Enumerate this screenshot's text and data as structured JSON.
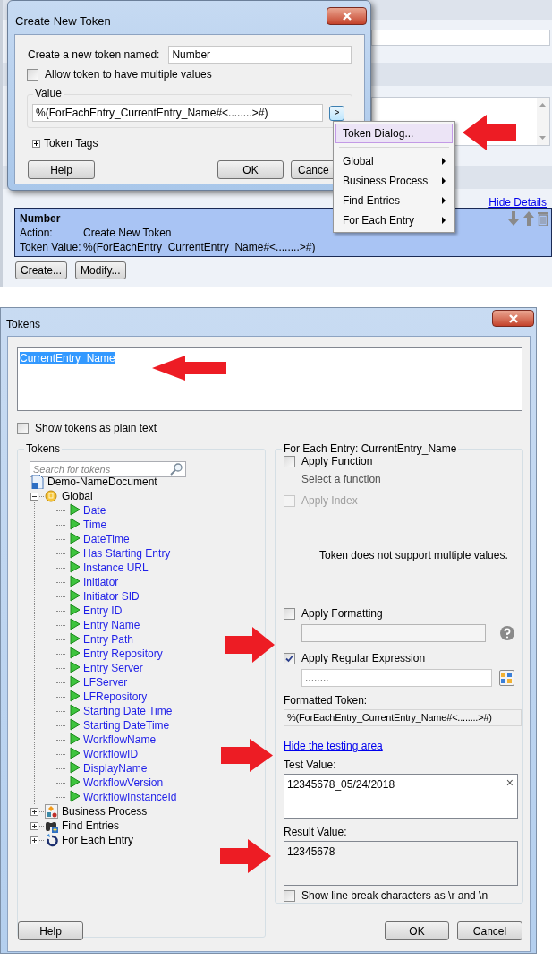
{
  "background_app": {
    "hide_details_link": "Hide Details",
    "selected_token": {
      "name": "Number",
      "rows": [
        {
          "label": "Action:",
          "value": "Create New Token"
        },
        {
          "label": "Token Value:",
          "value": "%(ForEachEntry_CurrentEntry_Name#<........>#)"
        }
      ]
    },
    "buttons": [
      "Create...",
      "Modify..."
    ]
  },
  "create_token_dialog": {
    "title": "Create New Token",
    "name_label": "Create a new token named:",
    "name_value": "Number",
    "multiple_values": {
      "label": "Allow token to have multiple values",
      "checked": false
    },
    "value_group": {
      "label": "Value",
      "value": "%(ForEachEntry_CurrentEntry_Name#<........>#)",
      "picker_button": ">"
    },
    "token_tags": {
      "label": "Token Tags",
      "expanded": false
    },
    "buttons": [
      "Help",
      "OK",
      "Cance"
    ]
  },
  "context_menu": {
    "sections": [
      [
        {
          "label": "Token Dialog...",
          "selected": true,
          "has_submenu": false
        }
      ],
      [
        {
          "label": "Global",
          "selected": false,
          "has_submenu": true
        },
        {
          "label": "Business Process",
          "selected": false,
          "has_submenu": true
        },
        {
          "label": "Find Entries",
          "selected": false,
          "has_submenu": true
        },
        {
          "label": "For Each Entry",
          "selected": false,
          "has_submenu": true
        }
      ]
    ]
  },
  "tokens_dialog": {
    "title": "Tokens",
    "expression": {
      "text": "CurrentEntry_Name",
      "selected": true
    },
    "plain_text": {
      "label": "Show tokens as plain text",
      "checked": false
    },
    "tokens_group": {
      "label": "Tokens",
      "search_placeholder": "Search for tokens",
      "tree": [
        {
          "label": "Demo-NameDocument",
          "kind": "document",
          "children": [
            {
              "label": "Global",
              "kind": "global",
              "expanded": true,
              "children": [
                {
                  "label": "Date",
                  "kind": "token"
                },
                {
                  "label": "Time",
                  "kind": "token"
                },
                {
                  "label": "DateTime",
                  "kind": "token"
                },
                {
                  "label": "Has Starting Entry",
                  "kind": "token"
                },
                {
                  "label": "Instance URL",
                  "kind": "token"
                },
                {
                  "label": "Initiator",
                  "kind": "token"
                },
                {
                  "label": "Initiator SID",
                  "kind": "token"
                },
                {
                  "label": "Entry ID",
                  "kind": "token"
                },
                {
                  "label": "Entry Name",
                  "kind": "token"
                },
                {
                  "label": "Entry Path",
                  "kind": "token"
                },
                {
                  "label": "Entry Repository",
                  "kind": "token"
                },
                {
                  "label": "Entry Server",
                  "kind": "token"
                },
                {
                  "label": "LFServer",
                  "kind": "token"
                },
                {
                  "label": "LFRepository",
                  "kind": "token"
                },
                {
                  "label": "Starting Date Time",
                  "kind": "token"
                },
                {
                  "label": "Starting DateTime",
                  "kind": "token"
                },
                {
                  "label": "WorkflowName",
                  "kind": "token"
                },
                {
                  "label": "WorkflowID",
                  "kind": "token"
                },
                {
                  "label": "DisplayName",
                  "kind": "token"
                },
                {
                  "label": "WorkflowVersion",
                  "kind": "token"
                },
                {
                  "label": "WorkflowInstanceId",
                  "kind": "token"
                }
              ]
            },
            {
              "label": "Business Process",
              "kind": "business",
              "expanded": false
            },
            {
              "label": "Find Entries",
              "kind": "find",
              "expanded": false
            },
            {
              "label": "For Each Entry",
              "kind": "foreach",
              "expanded": false
            }
          ]
        }
      ]
    },
    "options_group": {
      "label": "For Each Entry: CurrentEntry_Name",
      "apply_function": {
        "label": "Apply Function",
        "checked": false,
        "disabled": false,
        "hint": "Select a function"
      },
      "apply_index": {
        "label": "Apply Index",
        "checked": false,
        "disabled": true
      },
      "message": "Token does not support multiple values.",
      "apply_formatting": {
        "label": "Apply Formatting",
        "checked": false,
        "disabled": false
      },
      "apply_regex": {
        "label": "Apply Regular Expression",
        "checked": true,
        "disabled": false,
        "value": "........"
      },
      "formatted_label": "Formatted Token:",
      "formatted_value": "%(ForEachEntry_CurrentEntry_Name#<........>#)",
      "testing_link": "Hide the testing area",
      "test_label": "Test Value:",
      "test_value": "12345678_05/24/2018",
      "clear_button": "×",
      "result_label": "Result Value:",
      "result_value": "12345678",
      "line_breaks": {
        "label": "Show line break characters as \\r and \\n",
        "checked": false
      }
    },
    "buttons": [
      "Help",
      "OK",
      "Cancel"
    ]
  }
}
